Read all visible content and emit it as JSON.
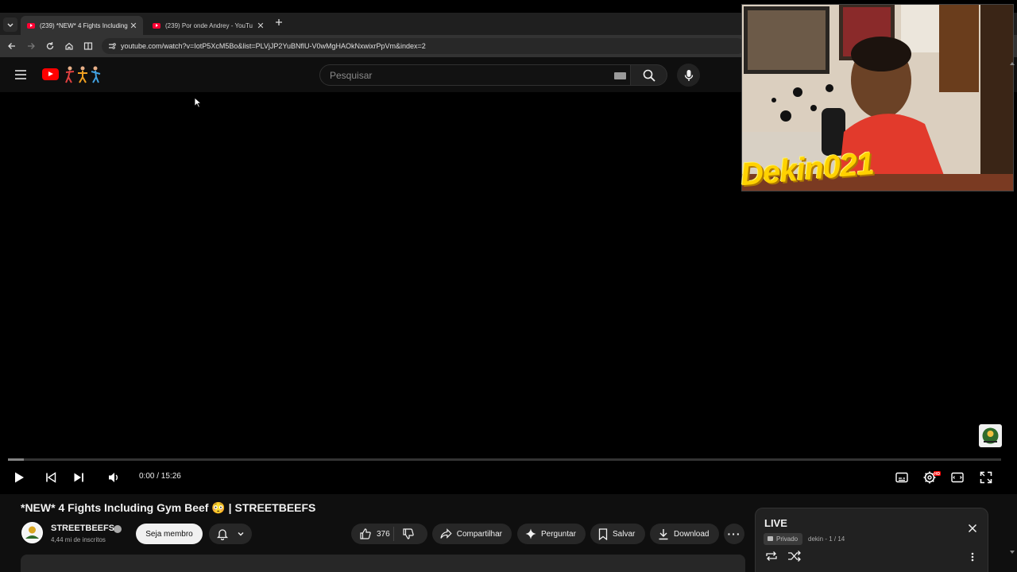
{
  "browser": {
    "tabs": [
      {
        "title": "(239) *NEW* 4 Fights Including",
        "active": true
      },
      {
        "title": "(239) Por onde Andrey - YouTu",
        "active": false
      }
    ],
    "new_tab_icon": "plus-icon",
    "url": "youtube.com/watch?v=IotP5XcM5Bo&list=PLVjJP2YuBNflU-V0wMgHAOkNxwixrPpVm&index=2"
  },
  "masthead": {
    "search_placeholder": "Pesquisar",
    "brand_color": "#ff0000"
  },
  "player": {
    "time_current": "0:00",
    "time_total": "15:26",
    "time_display": "0:00 / 15:26",
    "progress": 0,
    "buffered_fraction": 0.016,
    "hd_badge": "HD"
  },
  "webcam": {
    "sign_text": "Dekin021"
  },
  "video": {
    "title": "*NEW* 4 Fights Including Gym Beef 😳 | STREETBEEFS",
    "channel_name": "STREETBEEFS",
    "subscribers": "4,44 mi de inscritos",
    "member_button": "Seja membro",
    "likes": "376",
    "share_label": "Compartilhar",
    "ask_label": "Perguntar",
    "save_label": "Salvar",
    "download_label": "Download",
    "more_label": "···"
  },
  "playlist": {
    "title": "LIVE",
    "privacy": "Privado",
    "meta": "dekin - 1 / 14"
  },
  "colors": {
    "accent": "#ff0000",
    "background": "#0f0f0f",
    "pill": "#272727",
    "signature": "#ffd200"
  }
}
